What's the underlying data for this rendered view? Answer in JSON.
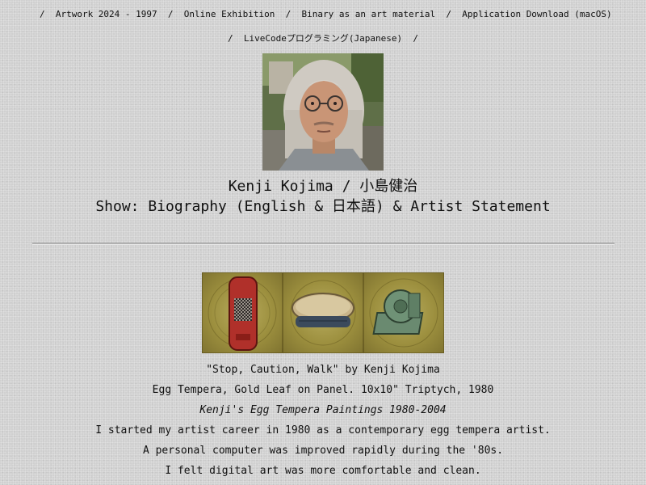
{
  "nav": {
    "row1": [
      {
        "label": "Artwork 2024 - 1997"
      },
      {
        "label": "Online Exhibition"
      },
      {
        "label": "Binary as an art material"
      },
      {
        "label": "Application Download (macOS)"
      }
    ],
    "row2": [
      {
        "label": "LiveCodeプログラミング(Japanese)"
      }
    ],
    "separator": "/"
  },
  "artist": {
    "name": "Kenji Kojima / 小島健治",
    "show_prefix": "Show: ",
    "show_link": "Biography (English & 日本語) & Artist Statement"
  },
  "artwork": {
    "title_line": "\"Stop, Caution, Walk\" by Kenji Kojima",
    "medium_line": "Egg Tempera, Gold Leaf on Panel. 10x10\" Triptych, 1980",
    "series_link": "Kenji's Egg Tempera Paintings 1980-2004"
  },
  "statement": [
    "I started my artist career in 1980 as a contemporary egg tempera artist.",
    "A personal computer was improved rapidly during the '80s.",
    "I felt digital art was more comfortable and clean."
  ],
  "colors": {
    "background": "#d0d0d0",
    "text": "#111111",
    "gold_panel": "#9c8f3e"
  },
  "icons": {
    "portrait": "artist-portrait-photo",
    "panel1": "red-traffic-signal-painting",
    "panel2": "brush-painting",
    "panel3": "caster-wheel-painting"
  }
}
